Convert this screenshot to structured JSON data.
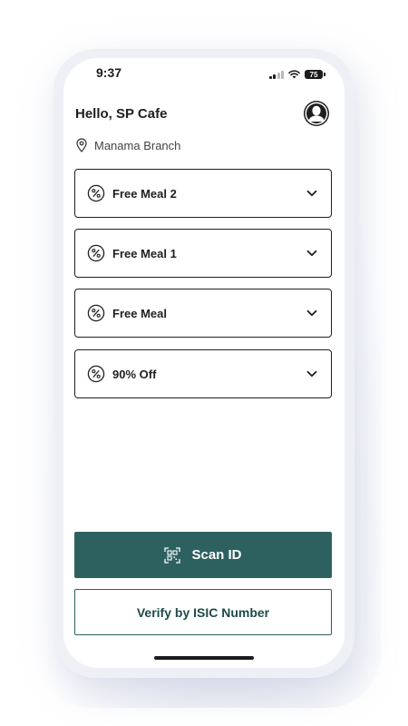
{
  "status_bar": {
    "time": "9:37",
    "battery": "75"
  },
  "header": {
    "greeting": "Hello, SP Cafe",
    "branch": "Manama Branch"
  },
  "offers": [
    {
      "title": "Free Meal 2"
    },
    {
      "title": "Free Meal 1"
    },
    {
      "title": "Free Meal"
    },
    {
      "title": "90% Off"
    }
  ],
  "actions": {
    "scan_label": "Scan ID",
    "isic_label": "Verify by ISIC Number"
  },
  "colors": {
    "accent": "#2d6160",
    "border": "#1f1f1f"
  },
  "icons": {
    "offer": "percent-badge-icon",
    "expand": "chevron-down-icon",
    "location": "location-pin-icon",
    "scan": "qr-scan-icon",
    "profile": "avatar-icon"
  }
}
